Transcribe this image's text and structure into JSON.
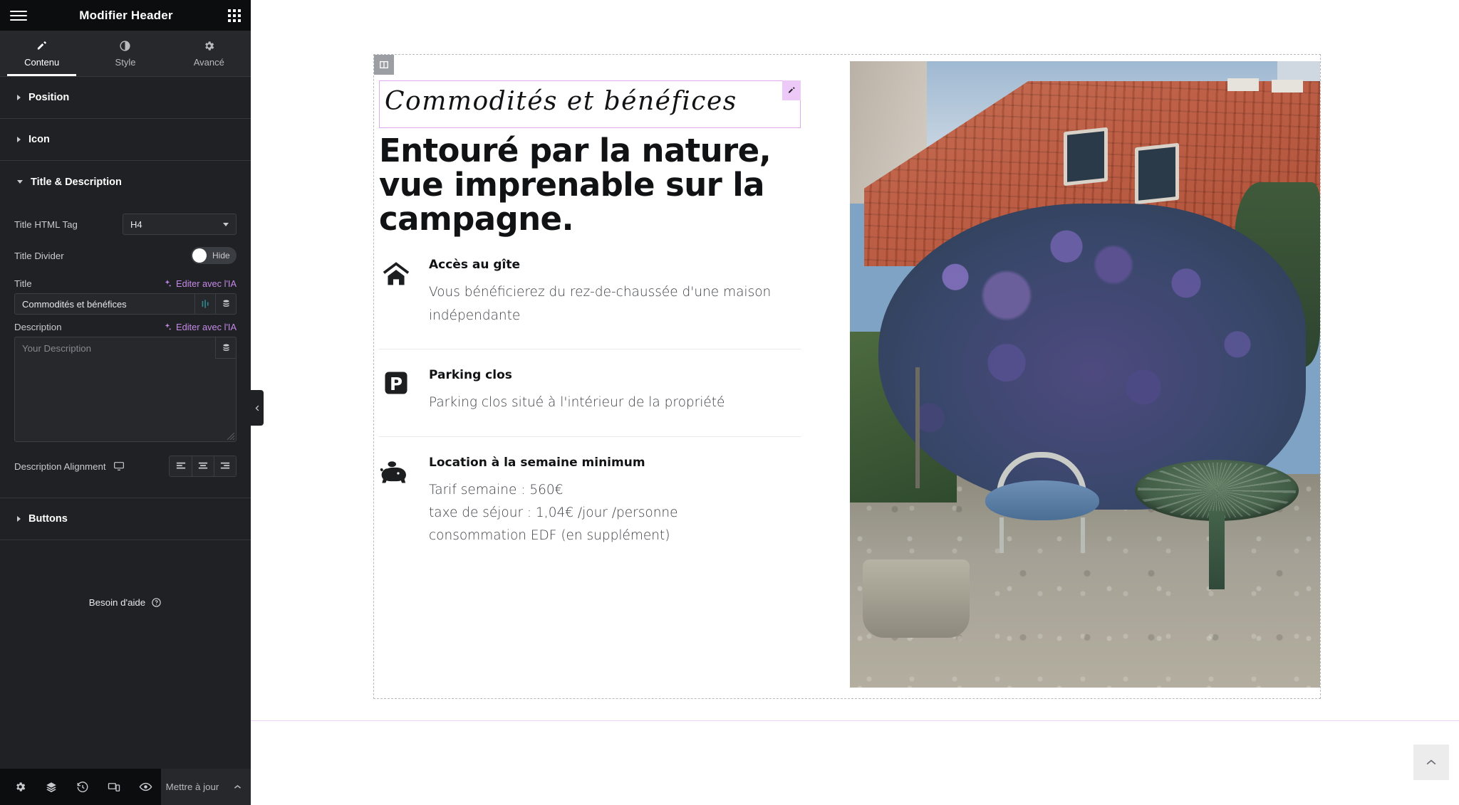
{
  "panel": {
    "header": {
      "title": "Modifier Header",
      "menu_icon": "hamburger-icon",
      "apps_icon": "grid-apps-icon"
    },
    "tabs": [
      {
        "label": "Contenu",
        "icon": "pencil-icon",
        "active": true
      },
      {
        "label": "Style",
        "icon": "contrast-icon",
        "active": false
      },
      {
        "label": "Avancé",
        "icon": "gear-icon",
        "active": false
      }
    ],
    "sections": [
      {
        "label": "Position",
        "expanded": false
      },
      {
        "label": "Icon",
        "expanded": false
      },
      {
        "label": "Title & Description",
        "expanded": true
      },
      {
        "label": "Buttons",
        "expanded": false
      }
    ],
    "controls": {
      "title_html_tag_label": "Title HTML Tag",
      "title_html_tag_value": "H4",
      "title_divider_label": "Title Divider",
      "title_divider_state": "Hide",
      "title_label": "Title",
      "title_ai_link": "Editer avec l'IA",
      "title_value": "Commodités et bénéfices",
      "description_label": "Description",
      "description_ai_link": "Editer avec l'IA",
      "description_placeholder": "Your Description",
      "description_value": "",
      "alignment_label": "Description Alignment",
      "alignment_device": "desktop-icon",
      "alignment_options": [
        "align-left",
        "align-center",
        "align-right"
      ]
    },
    "help": {
      "label": "Besoin d'aide",
      "icon": "question-circle-icon"
    },
    "footer": {
      "icons": [
        "settings-gear-icon",
        "layers-icon",
        "history-icon",
        "responsive-mode-icon",
        "preview-eye-icon"
      ],
      "update_label": "Mettre à jour"
    },
    "collapse_handle_icon": "chevron-left-icon"
  },
  "canvas": {
    "section_handle_icon": "columns-icon",
    "script_title": "Commodités et bénéfices",
    "edit_handle_icon": "pencil-edit-icon",
    "heading": "Entouré par la nature, vue imprenable sur la campagne.",
    "features": [
      {
        "icon": "home-icon",
        "title": "Accès au gîte",
        "lines": [
          "Vous bénéficierez du rez-de-chaussée d'une maison",
          "indépendante"
        ]
      },
      {
        "icon": "parking-icon",
        "title": "Parking clos",
        "lines": [
          "Parking clos situé à l'intérieur de la propriété"
        ]
      },
      {
        "icon": "piggy-bank-icon",
        "title": "Location à la semaine minimum",
        "lines": [
          "Tarif semaine : 560€",
          "taxe de séjour : 1,04€ /jour /personne",
          "consommation EDF (en supplément)"
        ]
      }
    ],
    "photo_alt": "maison avec toit en tuiles et jardin fleuri",
    "scroll_top_icon": "chevron-up-icon"
  },
  "colors": {
    "panel_bg": "#1f2124",
    "panel_header_bg": "#0c0d0e",
    "accent_ai": "#c58ae8",
    "selection_border": "#dfa9f0",
    "edit_pill": "#edc9f7"
  }
}
